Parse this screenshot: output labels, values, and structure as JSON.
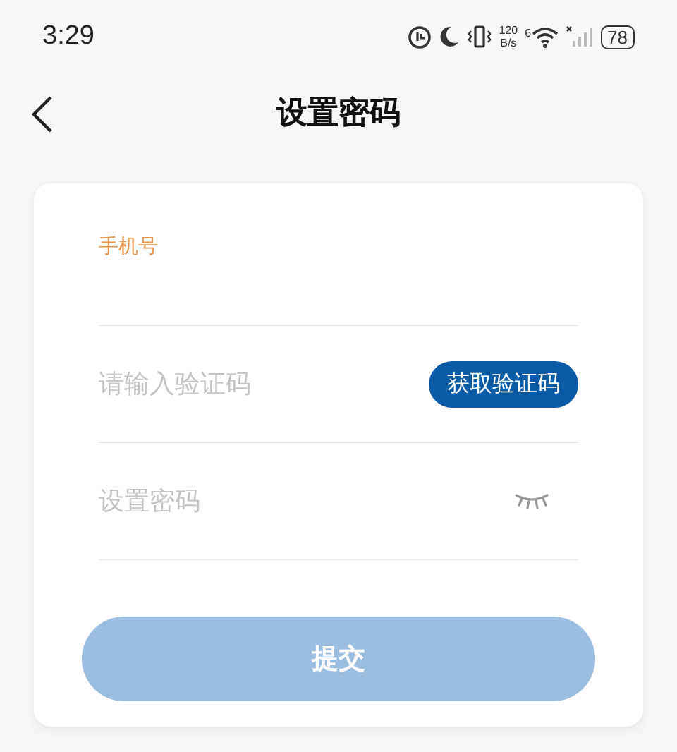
{
  "status_bar": {
    "time": "3:29",
    "net_speed_value": "120",
    "net_speed_unit": "B/s",
    "wifi_badge": "6",
    "battery": "78"
  },
  "header": {
    "title": "设置密码"
  },
  "form": {
    "fields": [
      {
        "kind": "phone",
        "label": "手机号"
      },
      {
        "kind": "code",
        "placeholder": "请输入验证码",
        "button": "获取验证码"
      },
      {
        "kind": "password",
        "placeholder": "设置密码"
      }
    ],
    "submit": {
      "label": "提交",
      "disabled": true
    }
  }
}
